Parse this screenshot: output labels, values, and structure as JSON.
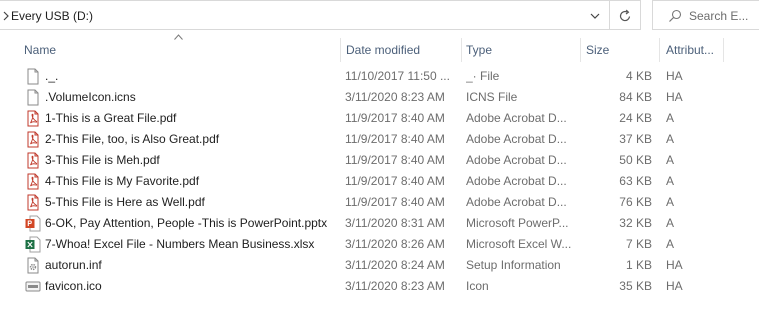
{
  "address": {
    "location": "Every USB (D:)"
  },
  "search": {
    "placeholder": "Search E..."
  },
  "columns": {
    "name": "Name",
    "date": "Date modified",
    "type": "Type",
    "size": "Size",
    "attributes": "Attribut..."
  },
  "files": [
    {
      "name": "._.",
      "date": "11/10/2017 11:50 ...",
      "type": "_· File",
      "size": "4 KB",
      "attr": "HA",
      "icon": "blank-file-icon"
    },
    {
      "name": ".VolumeIcon.icns",
      "date": "3/11/2020 8:23 AM",
      "type": "ICNS File",
      "size": "84 KB",
      "attr": "HA",
      "icon": "blank-file-icon"
    },
    {
      "name": "1-This is a Great File.pdf",
      "date": "11/9/2017 8:40 AM",
      "type": "Adobe Acrobat D...",
      "size": "24 KB",
      "attr": "A",
      "icon": "pdf-file-icon"
    },
    {
      "name": "2-This File, too, is Also Great.pdf",
      "date": "11/9/2017 8:40 AM",
      "type": "Adobe Acrobat D...",
      "size": "37 KB",
      "attr": "A",
      "icon": "pdf-file-icon"
    },
    {
      "name": "3-This File is Meh.pdf",
      "date": "11/9/2017 8:40 AM",
      "type": "Adobe Acrobat D...",
      "size": "50 KB",
      "attr": "A",
      "icon": "pdf-file-icon"
    },
    {
      "name": "4-This File is My Favorite.pdf",
      "date": "11/9/2017 8:40 AM",
      "type": "Adobe Acrobat D...",
      "size": "63 KB",
      "attr": "A",
      "icon": "pdf-file-icon"
    },
    {
      "name": "5-This File is Here as Well.pdf",
      "date": "11/9/2017 8:40 AM",
      "type": "Adobe Acrobat D...",
      "size": "76 KB",
      "attr": "A",
      "icon": "pdf-file-icon"
    },
    {
      "name": "6-OK, Pay Attention, People -This is PowerPoint.pptx",
      "date": "3/11/2020 8:31 AM",
      "type": "Microsoft PowerP...",
      "size": "32 KB",
      "attr": "A",
      "icon": "powerpoint-file-icon"
    },
    {
      "name": "7-Whoa! Excel File - Numbers Mean Business.xlsx",
      "date": "3/11/2020 8:26 AM",
      "type": "Microsoft Excel W...",
      "size": "7 KB",
      "attr": "A",
      "icon": "excel-file-icon"
    },
    {
      "name": "autorun.inf",
      "date": "3/11/2020 8:24 AM",
      "type": "Setup Information",
      "size": "1 KB",
      "attr": "HA",
      "icon": "settings-file-icon"
    },
    {
      "name": "favicon.ico",
      "date": "3/11/2020 8:23 AM",
      "type": "Icon",
      "size": "35 KB",
      "attr": "HA",
      "icon": "usb-drive-icon"
    }
  ]
}
